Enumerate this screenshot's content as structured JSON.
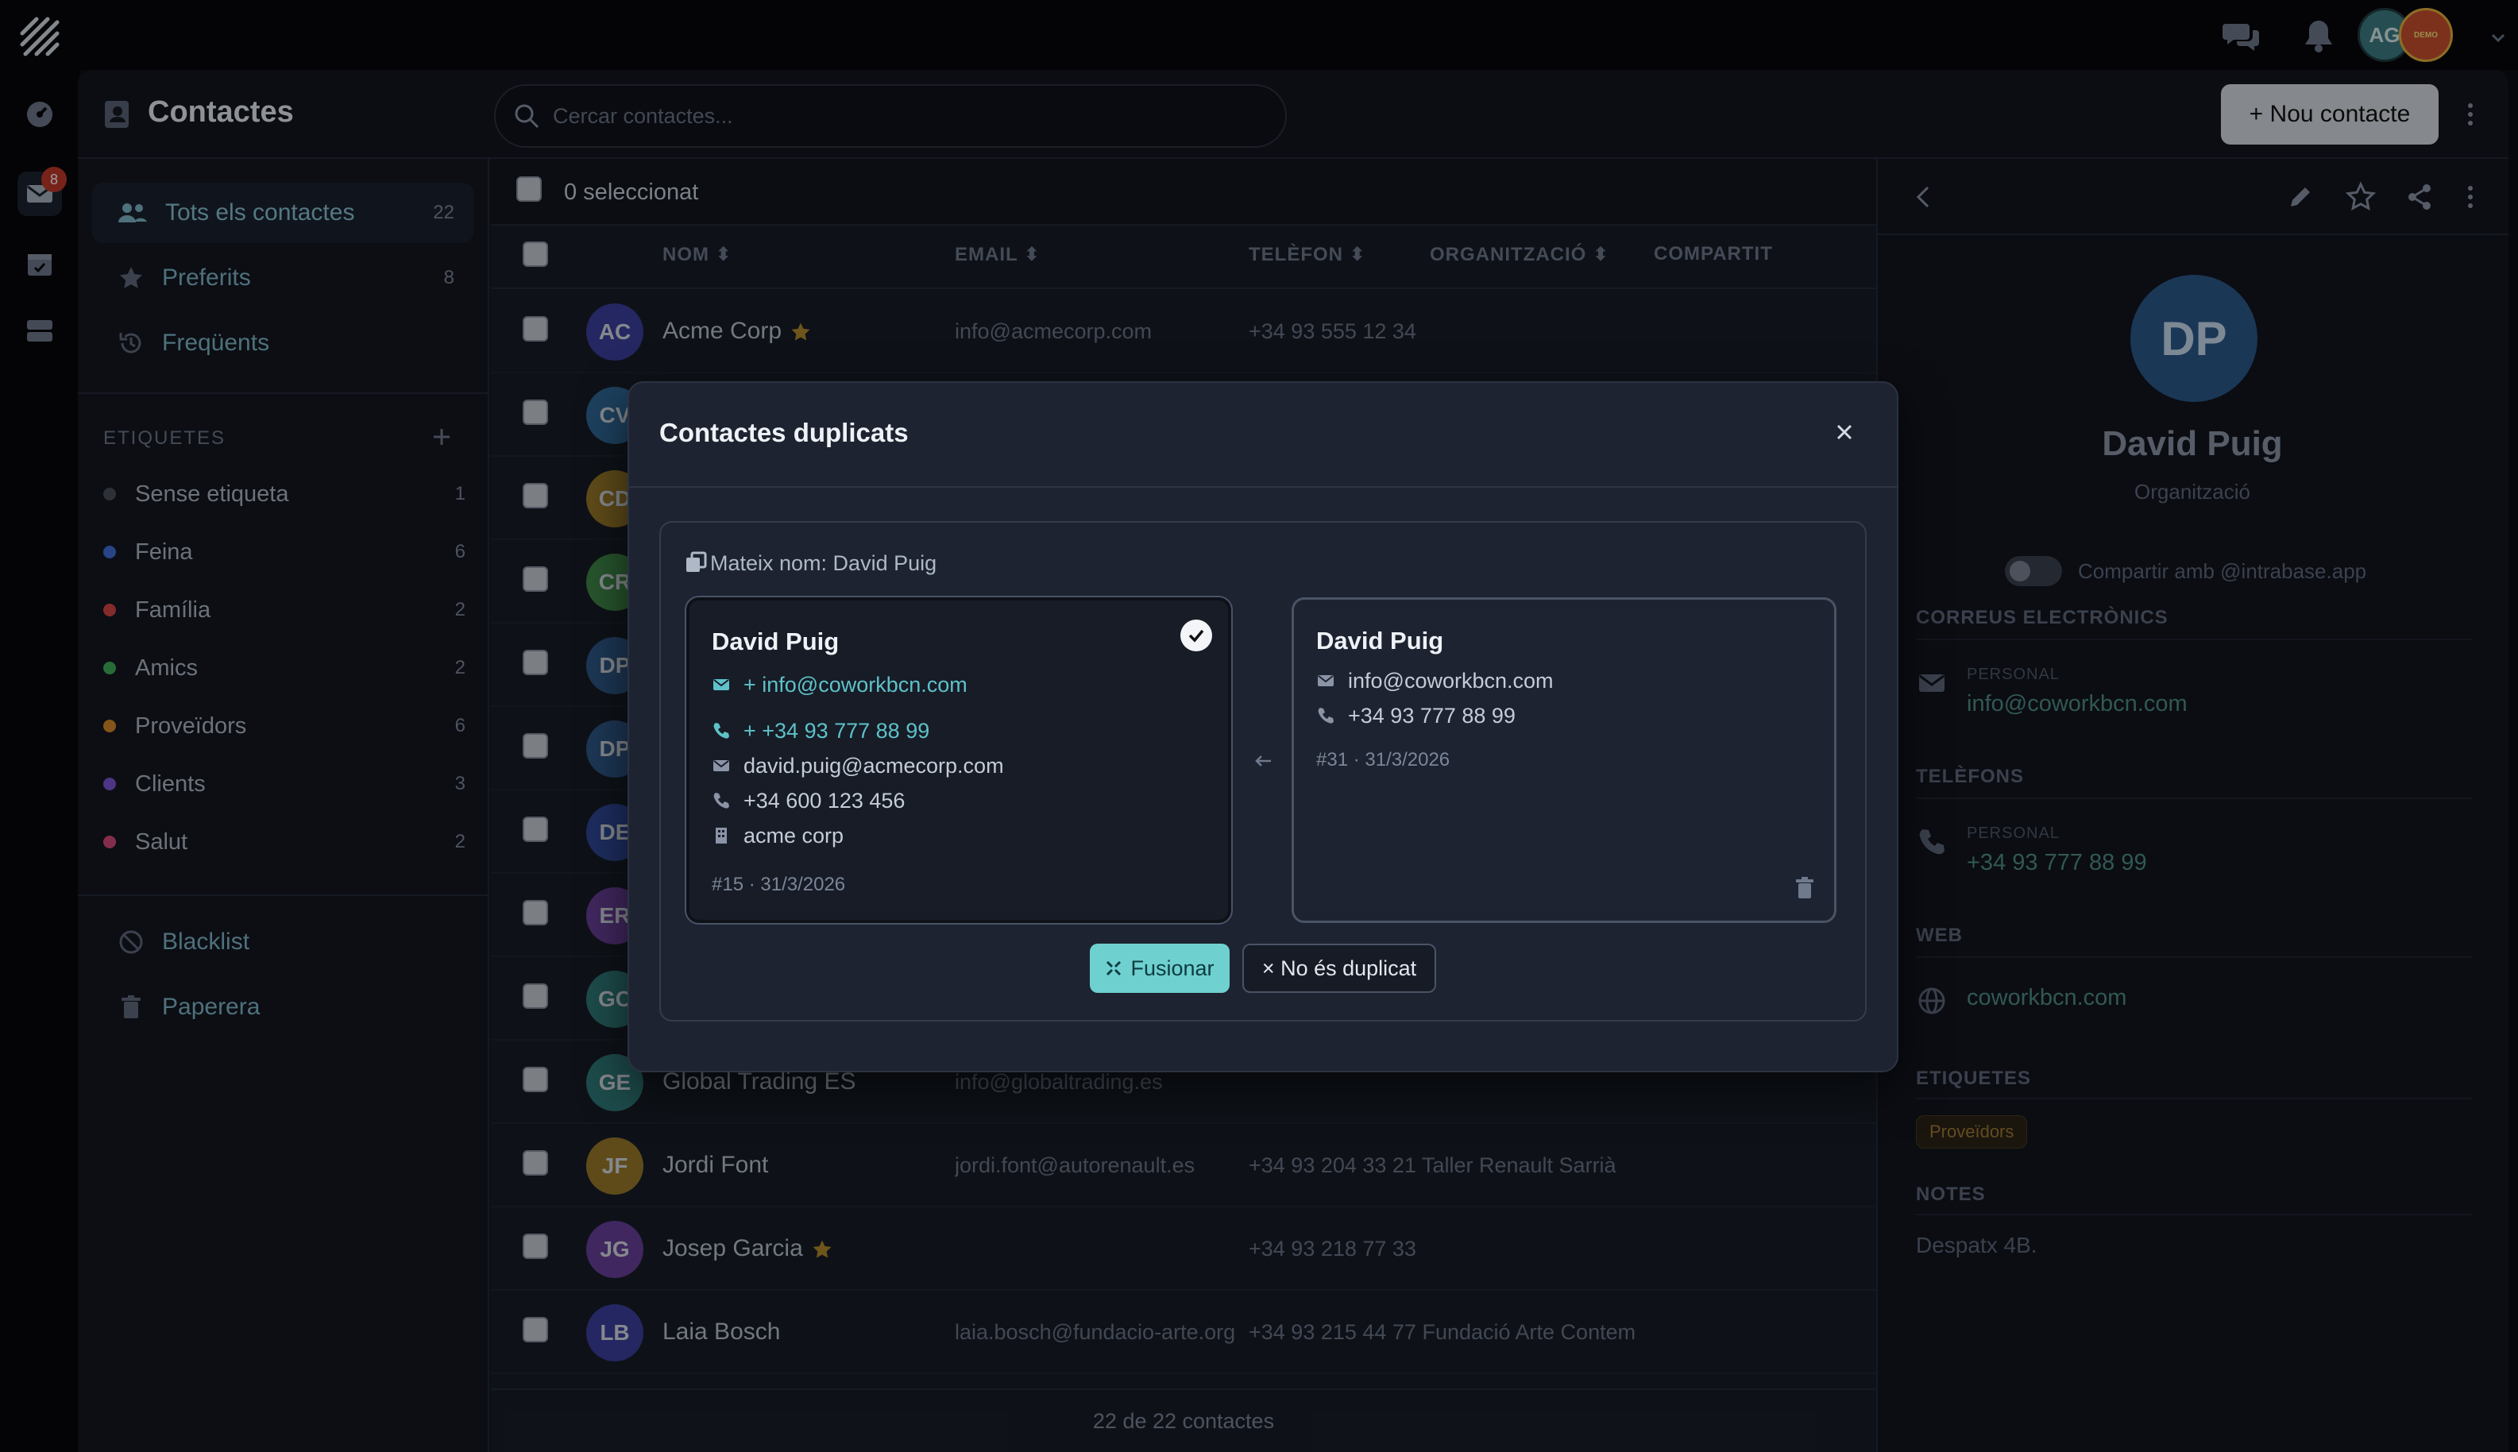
{
  "header": {
    "title": "Contactes",
    "search_placeholder": "Cercar contactes...",
    "new_contact_label": "+ Nou contacte",
    "avatar_initials": "AG",
    "demo_badge": "DEMO"
  },
  "rail": {
    "mail_badge": "8"
  },
  "sidebar": {
    "nav": [
      {
        "label": "Tots els contactes",
        "count": "22"
      },
      {
        "label": "Preferits",
        "count": "8"
      },
      {
        "label": "Freqüents",
        "count": ""
      }
    ],
    "tags_header": "ETIQUETES",
    "tags": [
      {
        "label": "Sense etiqueta",
        "count": "1",
        "color": "#4a4f5a"
      },
      {
        "label": "Feina",
        "count": "6",
        "color": "#3f6fd8"
      },
      {
        "label": "Família",
        "count": "2",
        "color": "#d64545"
      },
      {
        "label": "Amics",
        "count": "2",
        "color": "#3fae5a"
      },
      {
        "label": "Proveïdors",
        "count": "6",
        "color": "#d68a2a"
      },
      {
        "label": "Clients",
        "count": "3",
        "color": "#7b55d8"
      },
      {
        "label": "Salut",
        "count": "2",
        "color": "#d64a7a"
      }
    ],
    "blacklist": "Blacklist",
    "trash": "Paperera"
  },
  "list": {
    "selected_label": "0 seleccionat",
    "columns": {
      "name": "NOM",
      "email": "EMAIL",
      "phone": "TELÈFON",
      "org": "ORGANITZACIÓ",
      "shared": "COMPARTIT"
    },
    "rows": [
      {
        "initials": "AC",
        "name": "Acme Corp",
        "email": "info@acmecorp.com",
        "phone": "+34 93 555 12 34",
        "color": "#3d3f9e",
        "fav": true
      },
      {
        "initials": "CV",
        "name": "",
        "email": "",
        "phone": "",
        "color": "#2f6a9a",
        "fav": false
      },
      {
        "initials": "CD",
        "name": "",
        "email": "",
        "phone": "",
        "color": "#9a7a2a",
        "fav": false
      },
      {
        "initials": "CR",
        "name": "",
        "email": "",
        "phone": "",
        "color": "#3f8a4a",
        "fav": false
      },
      {
        "initials": "DP",
        "name": "",
        "email": "",
        "phone": "",
        "color": "#2f5a8a",
        "fav": false
      },
      {
        "initials": "DP",
        "name": "",
        "email": "",
        "phone": "",
        "color": "#2f5a8a",
        "fav": false
      },
      {
        "initials": "DE",
        "name": "",
        "email": "",
        "phone": "",
        "color": "#2f4a9a",
        "fav": false
      },
      {
        "initials": "ER",
        "name": "",
        "email": "",
        "phone": "",
        "color": "#6a3f9a",
        "fav": false
      },
      {
        "initials": "GC",
        "name": "",
        "email": "",
        "phone": "",
        "color": "#2f7a7a",
        "fav": false
      },
      {
        "initials": "GE",
        "name": "Global Trading ES",
        "email": "info@globaltrading.es",
        "phone": "",
        "color": "#2f7a7a",
        "fav": false
      },
      {
        "initials": "JF",
        "name": "Jordi Font",
        "email": "jordi.font@autorenault.es",
        "phone": "+34 93 204 33 21 Taller Renault Sarrià",
        "color": "#9a7a2a",
        "fav": false
      },
      {
        "initials": "JG",
        "name": "Josep Garcia",
        "email": "",
        "phone": "+34 93 218 77 33",
        "color": "#6a3f9a",
        "fav": true
      },
      {
        "initials": "LB",
        "name": "Laia Bosch",
        "email": "laia.bosch@fundacio-arte.org",
        "phone": "+34 93 215 44 77  Fundació Arte Contem",
        "color": "#3d3f9e",
        "fav": false
      }
    ],
    "footer": "22 de 22 contactes"
  },
  "detail": {
    "initials": "DP",
    "name": "David Puig",
    "org": "Organització",
    "share_label": "Compartir amb @intrabase.app",
    "emails_header": "CORREUS ELECTRÒNICS",
    "email_type": "PERSONAL",
    "email": "info@coworkbcn.com",
    "phones_header": "TELÈFONS",
    "phone_type": "PERSONAL",
    "phone": "+34 93 777 88 99",
    "web_header": "WEB",
    "web": "coworkbcn.com",
    "tags_header": "ETIQUETES",
    "tag": "Proveïdors",
    "notes_header": "NOTES",
    "notes": "Despatx 4B."
  },
  "modal": {
    "title": "Contactes duplicats",
    "group_label": "Mateix nom: David Puig",
    "primary": {
      "name": "David Puig",
      "added_email": "+ info@coworkbcn.com",
      "added_phone": "+ +34 93 777 88 99",
      "email": "david.puig@acmecorp.com",
      "phone": "+34 600 123 456",
      "org": "acme corp",
      "meta": "#15 · 31/3/2026"
    },
    "duplicate": {
      "name": "David Puig",
      "email": "info@coworkbcn.com",
      "phone": "+34 93 777 88 99",
      "meta": "#31 · 31/3/2026"
    },
    "merge_label": "Fusionar",
    "not_duplicate_label": "× No és duplicat"
  }
}
